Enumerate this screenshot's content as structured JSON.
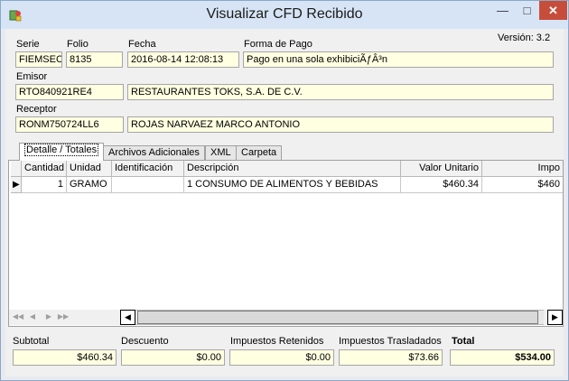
{
  "window": {
    "title": "Visualizar CFD Recibido"
  },
  "header": {
    "version": "Versión: 3.2",
    "serie_label": "Serie",
    "serie": "FIEMSEC",
    "folio_label": "Folio",
    "folio": "8135",
    "fecha_label": "Fecha",
    "fecha": "2016-08-14 12:08:13",
    "forma_pago_label": "Forma de Pago",
    "forma_pago": "Pago en una sola exhibiciÃƒÂ³n",
    "emisor_label": "Emisor",
    "emisor_rfc": "RTO840921RE4",
    "emisor_nombre": "RESTAURANTES TOKS, S.A. DE C.V.",
    "receptor_label": "Receptor",
    "receptor_rfc": "RONM750724LL6",
    "receptor_nombre": "ROJAS NARVAEZ MARCO ANTONIO"
  },
  "tabs": [
    "Detalle / Totales",
    "Archivos Adicionales",
    "XML",
    "Carpeta"
  ],
  "grid": {
    "columns": [
      "Cantidad",
      "Unidad",
      "Identificación",
      "Descripción",
      "Valor Unitario",
      "Impo"
    ],
    "rows": [
      [
        "1",
        "GRAMO",
        "",
        "1 CONSUMO DE ALIMENTOS Y BEBIDAS",
        "$460.34",
        "$460"
      ]
    ]
  },
  "totals": {
    "subtotal_label": "Subtotal",
    "subtotal": "$460.34",
    "descuento_label": "Descuento",
    "descuento": "$0.00",
    "retenidos_label": "Impuestos Retenidos",
    "retenidos": "$0.00",
    "trasladados_label": "Impuestos Trasladados",
    "trasladados": "$73.66",
    "total_label": "Total",
    "total": "$534.00"
  },
  "icons": {
    "app": "app-icon",
    "minimize": "minimize-icon",
    "maximize": "maximize-icon",
    "close": "close-icon",
    "row_indicator": "current-row-icon",
    "nav_first": "first-record-icon",
    "nav_prev": "previous-record-icon",
    "nav_next": "next-record-icon",
    "nav_last": "last-record-icon",
    "scroll_left": "scroll-left-icon",
    "scroll_right": "scroll-right-icon"
  },
  "colors": {
    "field_bg": "#ffffe1",
    "titlebar": "#d6e4f5",
    "close_button": "#c74d3b"
  }
}
